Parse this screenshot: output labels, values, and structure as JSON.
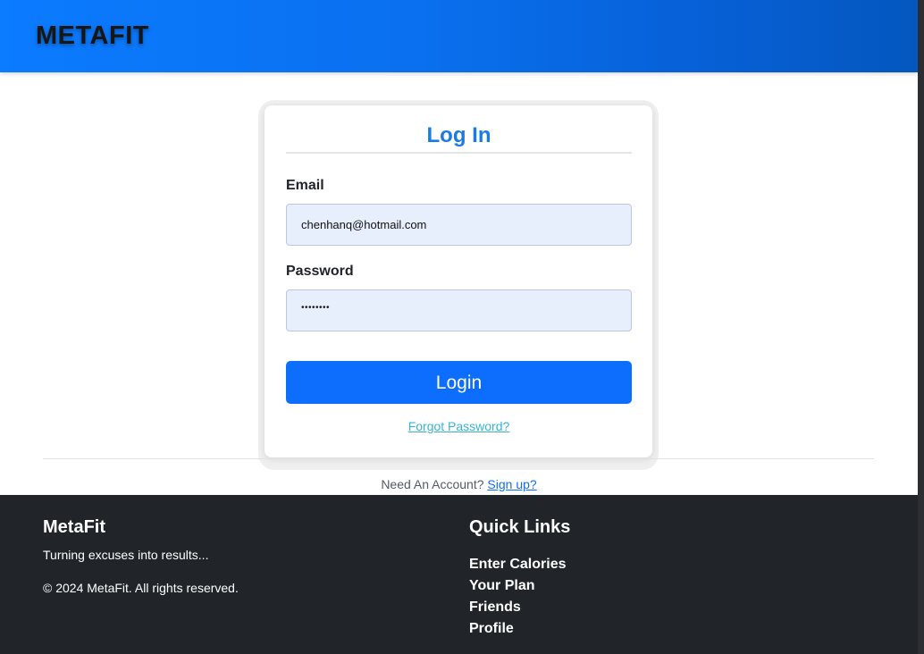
{
  "navbar": {
    "brand": "METAFIT"
  },
  "login": {
    "title": "Log In",
    "email_label": "Email",
    "email_value": "chenhanq@hotmail.com",
    "password_label": "Password",
    "password_masked": "••••••••",
    "submit_label": "Login",
    "forgot_link": "Forgot Password?"
  },
  "signup": {
    "prompt": "Need An Account?",
    "link": "Sign up?"
  },
  "footer": {
    "brand": "MetaFit",
    "tagline": "Turning excuses into results...",
    "copyright": "© 2024 MetaFit. All rights reserved.",
    "links_title": "Quick Links",
    "links": [
      "Enter Calories",
      "Your Plan",
      "Friends",
      "Profile"
    ]
  },
  "colors": {
    "primary": "#0d6efd",
    "title_accent": "#1c7ae6",
    "footer_bg": "#212529",
    "input_bg": "#e8effc"
  }
}
